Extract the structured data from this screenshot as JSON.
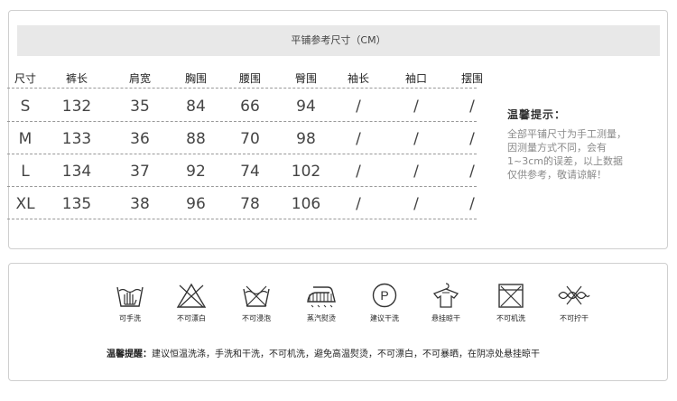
{
  "size_chart": {
    "title": "平铺参考尺寸（CM）",
    "headers": [
      "尺寸",
      "裤长",
      "肩宽",
      "胸围",
      "腰围",
      "臀围",
      "袖长",
      "袖口",
      "摆围"
    ],
    "rows": [
      [
        "S",
        "132",
        "35",
        "84",
        "66",
        "94",
        "/",
        "/",
        "/"
      ],
      [
        "M",
        "133",
        "36",
        "88",
        "70",
        "98",
        "/",
        "/",
        "/"
      ],
      [
        "L",
        "134",
        "37",
        "92",
        "74",
        "102",
        "/",
        "/",
        "/"
      ],
      [
        "XL",
        "135",
        "38",
        "96",
        "78",
        "106",
        "/",
        "/",
        "/"
      ]
    ]
  },
  "tips": {
    "title": "温馨提示：",
    "lines": [
      "全部平铺尺寸为手工测量，",
      "因测量方式不同，会有",
      "1~3cm的误差，以上数据",
      "仅供参考，敬请谅解！"
    ]
  },
  "care": {
    "icons": [
      {
        "label": "可手洗",
        "icon": "hand-wash-icon"
      },
      {
        "label": "不可漂白",
        "icon": "no-bleach-icon"
      },
      {
        "label": "不可浸泡",
        "icon": "no-soak-icon"
      },
      {
        "label": "蒸汽熨烫",
        "icon": "steam-iron-icon"
      },
      {
        "label": "建议干洗",
        "icon": "dry-clean-icon"
      },
      {
        "label": "悬挂晾干",
        "icon": "hang-dry-icon"
      },
      {
        "label": "不可机洗",
        "icon": "no-machine-wash-icon"
      },
      {
        "label": "不可拧干",
        "icon": "no-wring-icon"
      }
    ],
    "note_label": "温馨提醒：",
    "note_text": "建议恒温洗涤，手洗和干洗，不可机洗，避免高温熨烫，不可漂白，不可暴晒，在阴凉处悬挂晾干"
  }
}
